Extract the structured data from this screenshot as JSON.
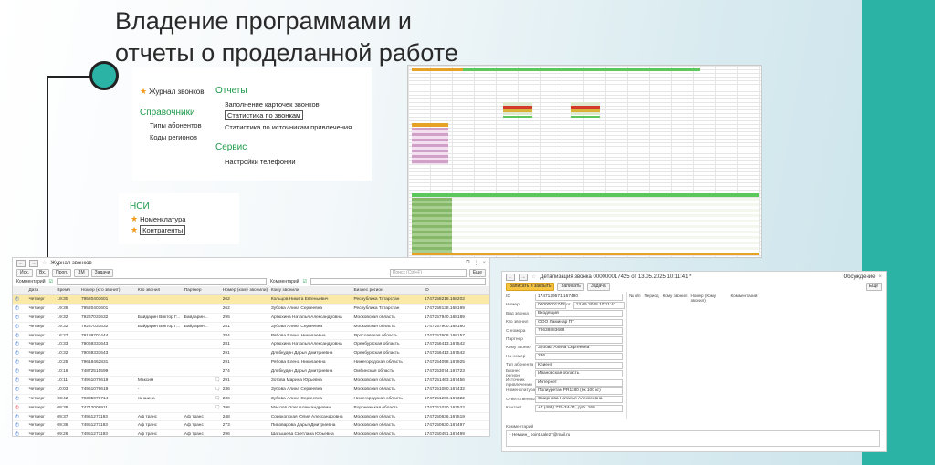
{
  "slide": {
    "title_line1": "Владение программами и",
    "title_line2": "отчеты о проделанной работе",
    "accent_color": "#2bb3a6"
  },
  "menu": {
    "journal": "Журнал звонков",
    "reports_header": "Отчеты",
    "reports": [
      "Заполнение карточек звонков",
      "Статистика по звонкам",
      "Статистика по источникам привлечения"
    ],
    "refs_header": "Справочники",
    "refs": [
      "Типы абонентов",
      "Коды регионов"
    ],
    "service_header": "Сервис",
    "service": [
      "Настройки телефонии"
    ]
  },
  "nsi": {
    "header": "НСИ",
    "items": [
      "Номенклатура",
      "Контрагенты"
    ]
  },
  "journal": {
    "title": "Журнал звонков",
    "toolbar": [
      "Исх.",
      "Вх.",
      "Проп.",
      "ЗМ",
      "Задачи"
    ],
    "search_placeholder": "Поиск (Ctrl+F)",
    "more": "Еще",
    "filter_label": "Комментарий",
    "filter_label2": "Комментарий",
    "columns": [
      "",
      "Дата",
      "Время",
      "Номер (кто звонит)",
      "Кто звонил",
      "Партнер",
      "",
      "Номер (кому звонили)",
      "Кому звонили",
      "Бизнес регион",
      "ID"
    ],
    "rows": [
      [
        "in",
        "Четверг",
        "19:30",
        "79520403601",
        "",
        "",
        "",
        "262",
        "Кольцов Никита Евгеньевич",
        "Республика Татарстан",
        "1747258218.168202"
      ],
      [
        "in",
        "Четверг",
        "19:36",
        "79520403601",
        "",
        "",
        "",
        "262",
        "Зубова Алина Сергеевна",
        "Республика Татарстан",
        "1747258138.168199"
      ],
      [
        "in",
        "Четверг",
        "19:32",
        "79267031632",
        "Байдарин Виктор Г...",
        "Байдарин...",
        "",
        "295",
        "Артюхина Наталья Александровна",
        "Московская область",
        "1747257940.168189"
      ],
      [
        "in",
        "Четверг",
        "19:32",
        "79267031632",
        "Байдарин Виктор Г...",
        "Байдарин...",
        "",
        "281",
        "Зубова Алина Сергеевна",
        "Московская область",
        "1747257900.168180"
      ],
      [
        "in",
        "Четверг",
        "16:27",
        "79189703444",
        "",
        "",
        "",
        "284",
        "Рябова Елена Николаевна",
        "Ярославская область",
        "1747257608.168157"
      ],
      [
        "in",
        "Четверг",
        "10:33",
        "79069333643",
        "",
        "",
        "",
        "281",
        "Артюхина Наталья Александровна",
        "Оренбургская область",
        "1747256413.167542"
      ],
      [
        "in",
        "Четверг",
        "10:32",
        "79069333643",
        "",
        "",
        "",
        "291",
        "Длябкудин Дарья Дмитриевна",
        "Оренбургская область",
        "1747256413.167542"
      ],
      [
        "in",
        "Четверг",
        "10:25",
        "79618462831",
        "",
        "",
        "",
        "291",
        "Рябова Елена Николаевна",
        "Нижегородская область",
        "1747254098.167925"
      ],
      [
        "in",
        "Четверг",
        "10:16",
        "74872515599",
        "",
        "",
        "",
        "274",
        "Длябкудин Дарья Дмитриевна",
        "Омбинская область",
        "1747253074.167723"
      ],
      [
        "in",
        "Четверг",
        "10:11",
        "74951079619",
        "Максим",
        "",
        "chat",
        "291",
        "Зотова Марина Юрьевна",
        "Московская область",
        "1747251463.167456"
      ],
      [
        "in",
        "Четверг",
        "10:03",
        "74951079619",
        "-",
        "",
        "chat",
        "236",
        "Зубова Алина Сергеевна",
        "Московская область",
        "1747251080.167432"
      ],
      [
        "in",
        "Четверг",
        "03:42",
        "79335078714",
        "ганшина",
        "",
        "chat",
        "236",
        "Зубова Алина Сергеевна",
        "Нижегородская область",
        "1747251206.167322"
      ],
      [
        "miss",
        "Четверг",
        "09:38",
        "74712008911",
        "",
        "",
        "chat",
        "296",
        "Маслов Олег Александрович",
        "Воронежская область",
        "1747251070.167522"
      ],
      [
        "in",
        "Четверг",
        "09:37",
        "74951271193",
        "Аф транс",
        "Аф транс",
        "",
        "248",
        "Сорокопская Юлия Александровна",
        "Московская область",
        "1747250636.167519"
      ],
      [
        "in",
        "Четверг",
        "09:36",
        "74951271193",
        "Аф транс",
        "Аф транс",
        "",
        "273",
        "Пивоварова Дарья Дмитриевна",
        "Московская область",
        "1747250630.167497"
      ],
      [
        "in",
        "Четверг",
        "09:26",
        "74951271193",
        "Аф транс",
        "Аф транс",
        "",
        "296",
        "Шатышева Светлана Юрьевна",
        "Московская область",
        "1747250491.167499"
      ]
    ],
    "selected_row": 0
  },
  "detail": {
    "title": "Детализация звонка 000000017425 от 13.05.2025 10:11:41 *",
    "discussion": "Обсуждение",
    "save_close": "Записать и закрыть",
    "save": "Записать",
    "task": "Задача",
    "more": "Еще",
    "fields": [
      [
        "ID",
        "1747129571.167480"
      ],
      [
        "Номер",
        "000000017425"
      ],
      [
        "Вид звонка",
        "Входящий"
      ],
      [
        "Кто звонил",
        "ООО Ламинар ПТ"
      ],
      [
        "С номера",
        "79638883669"
      ],
      [
        "Партнер",
        ""
      ],
      [
        "Кому звонил",
        "Зубова Алина Сергеевна"
      ],
      [
        "На номер",
        "236"
      ],
      [
        "Тип абонента",
        "Клиент"
      ],
      [
        "Бизнес регион",
        "Ивановская область"
      ],
      [
        "Источник привлечения",
        "Интернет"
      ],
      [
        "Номенклатура",
        "Полиуретан PR1180 (бк 100 кг)"
      ],
      [
        "Ответственный",
        "Смирнова Наталья Алексеевна"
      ],
      [
        "Контакт",
        "+7 (495) 770-34-71, доб. 166"
      ]
    ],
    "date_label": "от",
    "date_value": "13.05.2025 10:11:41",
    "side_columns": [
      "№ п/п",
      "Период",
      "Кому звонил",
      "Номер (Кому звонил)",
      "Комментарий"
    ],
    "comment_label": "Комментарий",
    "comment_value": "+ Немкин_ point.sale27@mail.ru"
  }
}
